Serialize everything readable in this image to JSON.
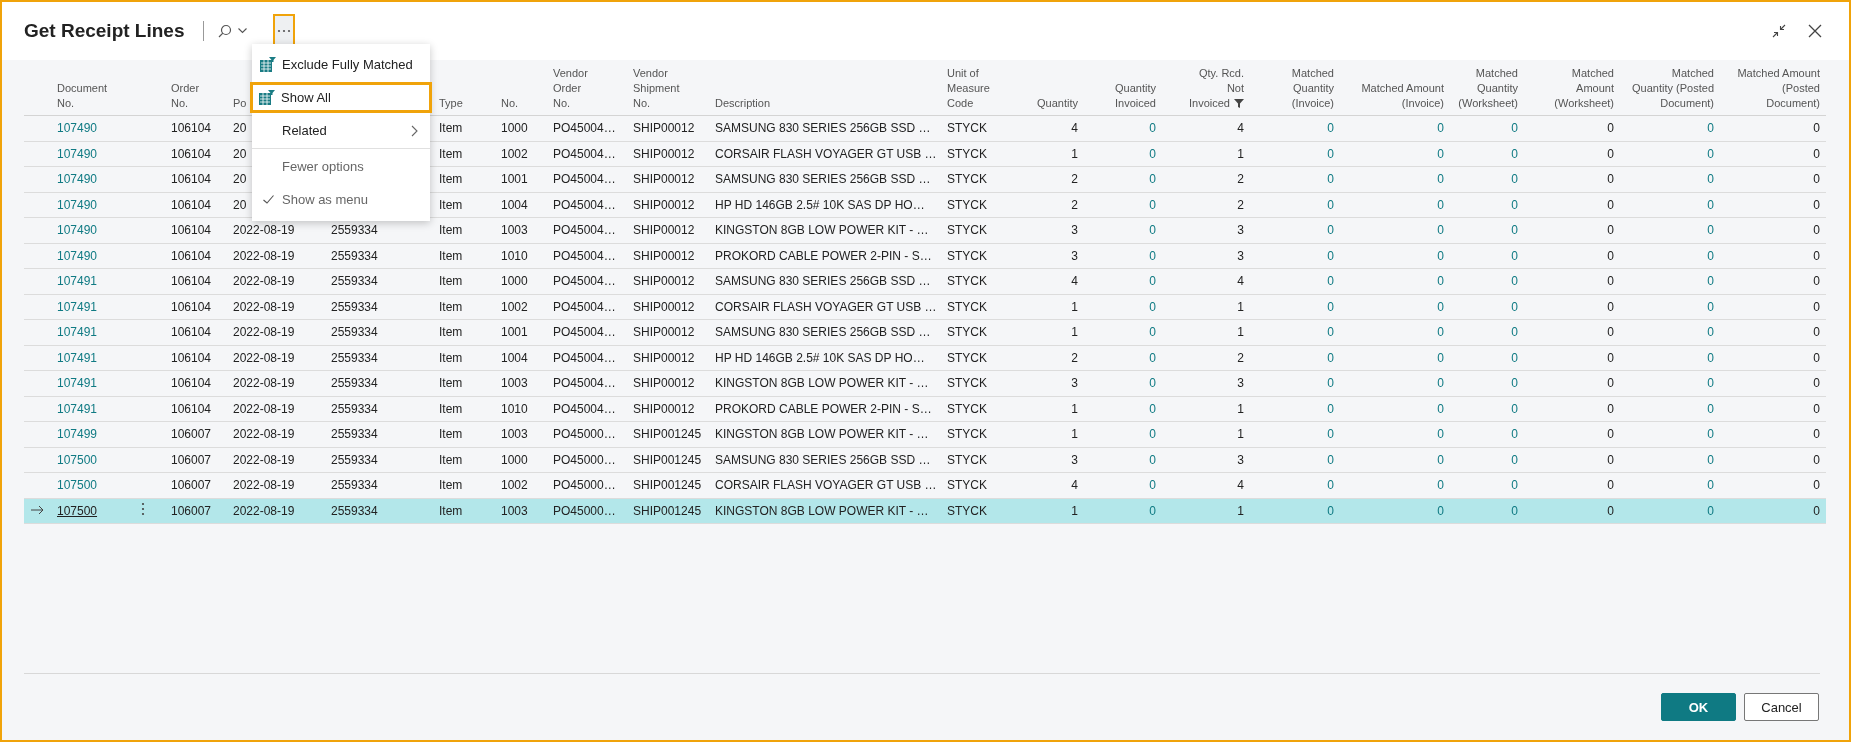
{
  "window": {
    "title": "Get Receipt Lines"
  },
  "toolbar": {
    "more_highlighted": true
  },
  "menu": [
    {
      "kind": "action",
      "label": "Exclude Fully Matched",
      "highlighted": false
    },
    {
      "kind": "action",
      "label": "Show All",
      "highlighted": true
    },
    {
      "kind": "submenu",
      "label": "Related",
      "highlighted": false
    },
    {
      "kind": "muted",
      "label": "Fewer options",
      "highlighted": false
    },
    {
      "kind": "toggle",
      "label": "Show as menu",
      "checked": true,
      "highlighted": false
    }
  ],
  "table": {
    "columns": [
      {
        "label": "Document\nNo.",
        "kind": "link",
        "filtered": false
      },
      {
        "label": "Order\nNo.",
        "kind": "text",
        "filtered": false
      },
      {
        "label": "Po",
        "kind": "text"
      },
      {
        "kind": "text"
      },
      {
        "label": "Type",
        "kind": "text",
        "filtered": false
      },
      {
        "label": "No.",
        "kind": "text",
        "filtered": false
      },
      {
        "label": "Vendor\nOrder\nNo.",
        "kind": "text",
        "filtered": false
      },
      {
        "label": "Vendor\nShipment\nNo.",
        "kind": "text",
        "filtered": false
      },
      {
        "label": "Description",
        "kind": "text",
        "filtered": false
      },
      {
        "label": "Unit of\nMeasure Code",
        "kind": "text",
        "filtered": false
      },
      {
        "label": "Quantity",
        "kind": "number",
        "filtered": false
      },
      {
        "label": "Quantity\nInvoiced",
        "kind": "number_link",
        "filtered": false
      },
      {
        "label": "Qty. Rcd.\nNot\nInvoiced",
        "kind": "number",
        "filtered": true
      },
      {
        "label": "Matched\nQuantity\n(Invoice)",
        "kind": "number_link",
        "filtered": false
      },
      {
        "label": "Matched Amount\n(Invoice)",
        "kind": "number_link",
        "filtered": false
      },
      {
        "label": "Matched\nQuantity\n(Worksheet)",
        "kind": "number_link",
        "filtered": false
      },
      {
        "label": "Matched\nAmount\n(Worksheet)",
        "kind": "number",
        "filtered": false
      },
      {
        "label": "Matched\nQuantity (Posted\nDocument)",
        "kind": "number_link",
        "filtered": false
      },
      {
        "label": "Matched Amount\n(Posted\nDocument)",
        "kind": "number",
        "filtered": false
      }
    ],
    "rows": [
      {
        "selected": false,
        "cells": [
          "107490",
          "106104",
          "20",
          null,
          "Item",
          "1000",
          "PO45004…",
          "SHIP00012",
          "SAMSUNG 830 SERIES 256GB SSD …",
          "STYCK",
          "4",
          "0",
          "4",
          "0",
          "0",
          "0",
          "0",
          "0",
          "0"
        ]
      },
      {
        "selected": false,
        "cells": [
          "107490",
          "106104",
          "20",
          null,
          "Item",
          "1002",
          "PO45004…",
          "SHIP00012",
          "CORSAIR FLASH VOYAGER GT USB …",
          "STYCK",
          "1",
          "0",
          "1",
          "0",
          "0",
          "0",
          "0",
          "0",
          "0"
        ]
      },
      {
        "selected": false,
        "cells": [
          "107490",
          "106104",
          "20",
          null,
          "Item",
          "1001",
          "PO45004…",
          "SHIP00012",
          "SAMSUNG 830 SERIES 256GB SSD …",
          "STYCK",
          "2",
          "0",
          "2",
          "0",
          "0",
          "0",
          "0",
          "0",
          "0"
        ]
      },
      {
        "selected": false,
        "cells": [
          "107490",
          "106104",
          "20",
          null,
          "Item",
          "1004",
          "PO45004…",
          "SHIP00012",
          "HP HD 146GB 2.5# 10K SAS DP HO…",
          "STYCK",
          "2",
          "0",
          "2",
          "0",
          "0",
          "0",
          "0",
          "0",
          "0"
        ]
      },
      {
        "selected": false,
        "cells": [
          "107490",
          "106104",
          "2022-08-19",
          "2559334",
          "Item",
          "1003",
          "PO45004…",
          "SHIP00012",
          "KINGSTON 8GB LOW POWER KIT - …",
          "STYCK",
          "3",
          "0",
          "3",
          "0",
          "0",
          "0",
          "0",
          "0",
          "0"
        ]
      },
      {
        "selected": false,
        "cells": [
          "107490",
          "106104",
          "2022-08-19",
          "2559334",
          "Item",
          "1010",
          "PO45004…",
          "SHIP00012",
          "PROKORD CABLE POWER 2-PIN - S…",
          "STYCK",
          "3",
          "0",
          "3",
          "0",
          "0",
          "0",
          "0",
          "0",
          "0"
        ]
      },
      {
        "selected": false,
        "cells": [
          "107491",
          "106104",
          "2022-08-19",
          "2559334",
          "Item",
          "1000",
          "PO45004…",
          "SHIP00012",
          "SAMSUNG 830 SERIES 256GB SSD …",
          "STYCK",
          "4",
          "0",
          "4",
          "0",
          "0",
          "0",
          "0",
          "0",
          "0"
        ]
      },
      {
        "selected": false,
        "cells": [
          "107491",
          "106104",
          "2022-08-19",
          "2559334",
          "Item",
          "1002",
          "PO45004…",
          "SHIP00012",
          "CORSAIR FLASH VOYAGER GT USB …",
          "STYCK",
          "1",
          "0",
          "1",
          "0",
          "0",
          "0",
          "0",
          "0",
          "0"
        ]
      },
      {
        "selected": false,
        "cells": [
          "107491",
          "106104",
          "2022-08-19",
          "2559334",
          "Item",
          "1001",
          "PO45004…",
          "SHIP00012",
          "SAMSUNG 830 SERIES 256GB SSD …",
          "STYCK",
          "1",
          "0",
          "1",
          "0",
          "0",
          "0",
          "0",
          "0",
          "0"
        ]
      },
      {
        "selected": false,
        "cells": [
          "107491",
          "106104",
          "2022-08-19",
          "2559334",
          "Item",
          "1004",
          "PO45004…",
          "SHIP00012",
          "HP HD 146GB 2.5# 10K SAS DP HO…",
          "STYCK",
          "2",
          "0",
          "2",
          "0",
          "0",
          "0",
          "0",
          "0",
          "0"
        ]
      },
      {
        "selected": false,
        "cells": [
          "107491",
          "106104",
          "2022-08-19",
          "2559334",
          "Item",
          "1003",
          "PO45004…",
          "SHIP00012",
          "KINGSTON 8GB LOW POWER KIT - …",
          "STYCK",
          "3",
          "0",
          "3",
          "0",
          "0",
          "0",
          "0",
          "0",
          "0"
        ]
      },
      {
        "selected": false,
        "cells": [
          "107491",
          "106104",
          "2022-08-19",
          "2559334",
          "Item",
          "1010",
          "PO45004…",
          "SHIP00012",
          "PROKORD CABLE POWER 2-PIN - S…",
          "STYCK",
          "1",
          "0",
          "1",
          "0",
          "0",
          "0",
          "0",
          "0",
          "0"
        ]
      },
      {
        "selected": false,
        "cells": [
          "107499",
          "106007",
          "2022-08-19",
          "2559334",
          "Item",
          "1003",
          "PO45000…",
          "SHIP001245",
          "KINGSTON 8GB LOW POWER KIT - …",
          "STYCK",
          "1",
          "0",
          "1",
          "0",
          "0",
          "0",
          "0",
          "0",
          "0"
        ]
      },
      {
        "selected": false,
        "cells": [
          "107500",
          "106007",
          "2022-08-19",
          "2559334",
          "Item",
          "1000",
          "PO45000…",
          "SHIP001245",
          "SAMSUNG 830 SERIES 256GB SSD …",
          "STYCK",
          "3",
          "0",
          "3",
          "0",
          "0",
          "0",
          "0",
          "0",
          "0"
        ]
      },
      {
        "selected": false,
        "cells": [
          "107500",
          "106007",
          "2022-08-19",
          "2559334",
          "Item",
          "1002",
          "PO45000…",
          "SHIP001245",
          "CORSAIR FLASH VOYAGER GT USB …",
          "STYCK",
          "4",
          "0",
          "4",
          "0",
          "0",
          "0",
          "0",
          "0",
          "0"
        ]
      },
      {
        "selected": true,
        "cells": [
          "107500",
          "106007",
          "2022-08-19",
          "2559334",
          "Item",
          "1003",
          "PO45000…",
          "SHIP001245",
          "KINGSTON 8GB LOW POWER KIT - …",
          "STYCK",
          "1",
          "0",
          "1",
          "0",
          "0",
          "0",
          "0",
          "0",
          "0"
        ]
      }
    ]
  },
  "buttons": [
    {
      "label": "OK",
      "kind": "primary"
    },
    {
      "label": "Cancel",
      "kind": "secondary"
    }
  ]
}
